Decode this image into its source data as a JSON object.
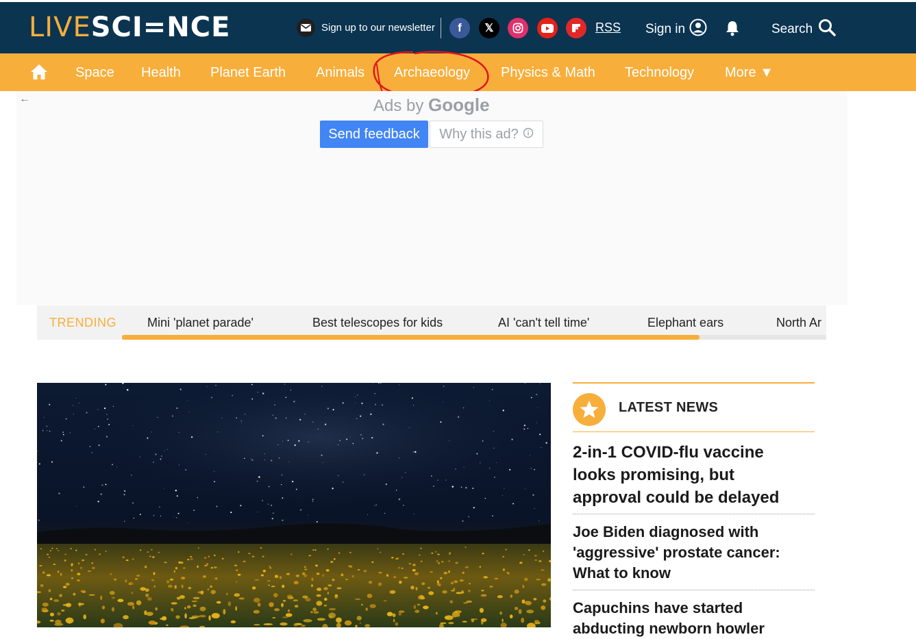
{
  "header": {
    "logo_live": "LIVE",
    "logo_science": "SCI=NCE",
    "newsletter_label": "Sign up to our newsletter",
    "social_icons": [
      "facebook-icon",
      "x-icon",
      "instagram-icon",
      "youtube-icon",
      "flipboard-icon"
    ],
    "social_glyphs": {
      "facebook": "f",
      "x": "𝕏"
    },
    "rss_label": "RSS",
    "signin_label": "Sign in",
    "search_label": "Search"
  },
  "nav": {
    "items": [
      "Space",
      "Health",
      "Planet Earth",
      "Animals",
      "Archaeology",
      "Physics & Math",
      "Technology",
      "More ▼"
    ]
  },
  "ad": {
    "ads_by": "Ads by",
    "google": "Google",
    "send_feedback": "Send feedback",
    "why_this_ad": "Why this ad?"
  },
  "trending": {
    "label": "TRENDING",
    "items": [
      "Mini 'planet parade'",
      "Best telescopes for kids",
      "AI 'can't tell time'",
      "Elephant ears",
      "North Ar"
    ],
    "scroll_progress": 0.82
  },
  "latest_news": {
    "title": "LATEST NEWS",
    "items": [
      "2-in-1 COVID-flu vaccine looks promising, but approval could be delayed",
      "Joe Biden diagnosed with 'aggressive' prostate cancer: What to know",
      "Capuchins have started abducting newborn howler"
    ]
  },
  "colors": {
    "header_bg": "#0b3451",
    "accent": "#f8ae3b",
    "google_blue": "#4285f4",
    "annotation_red": "#e0141e"
  }
}
